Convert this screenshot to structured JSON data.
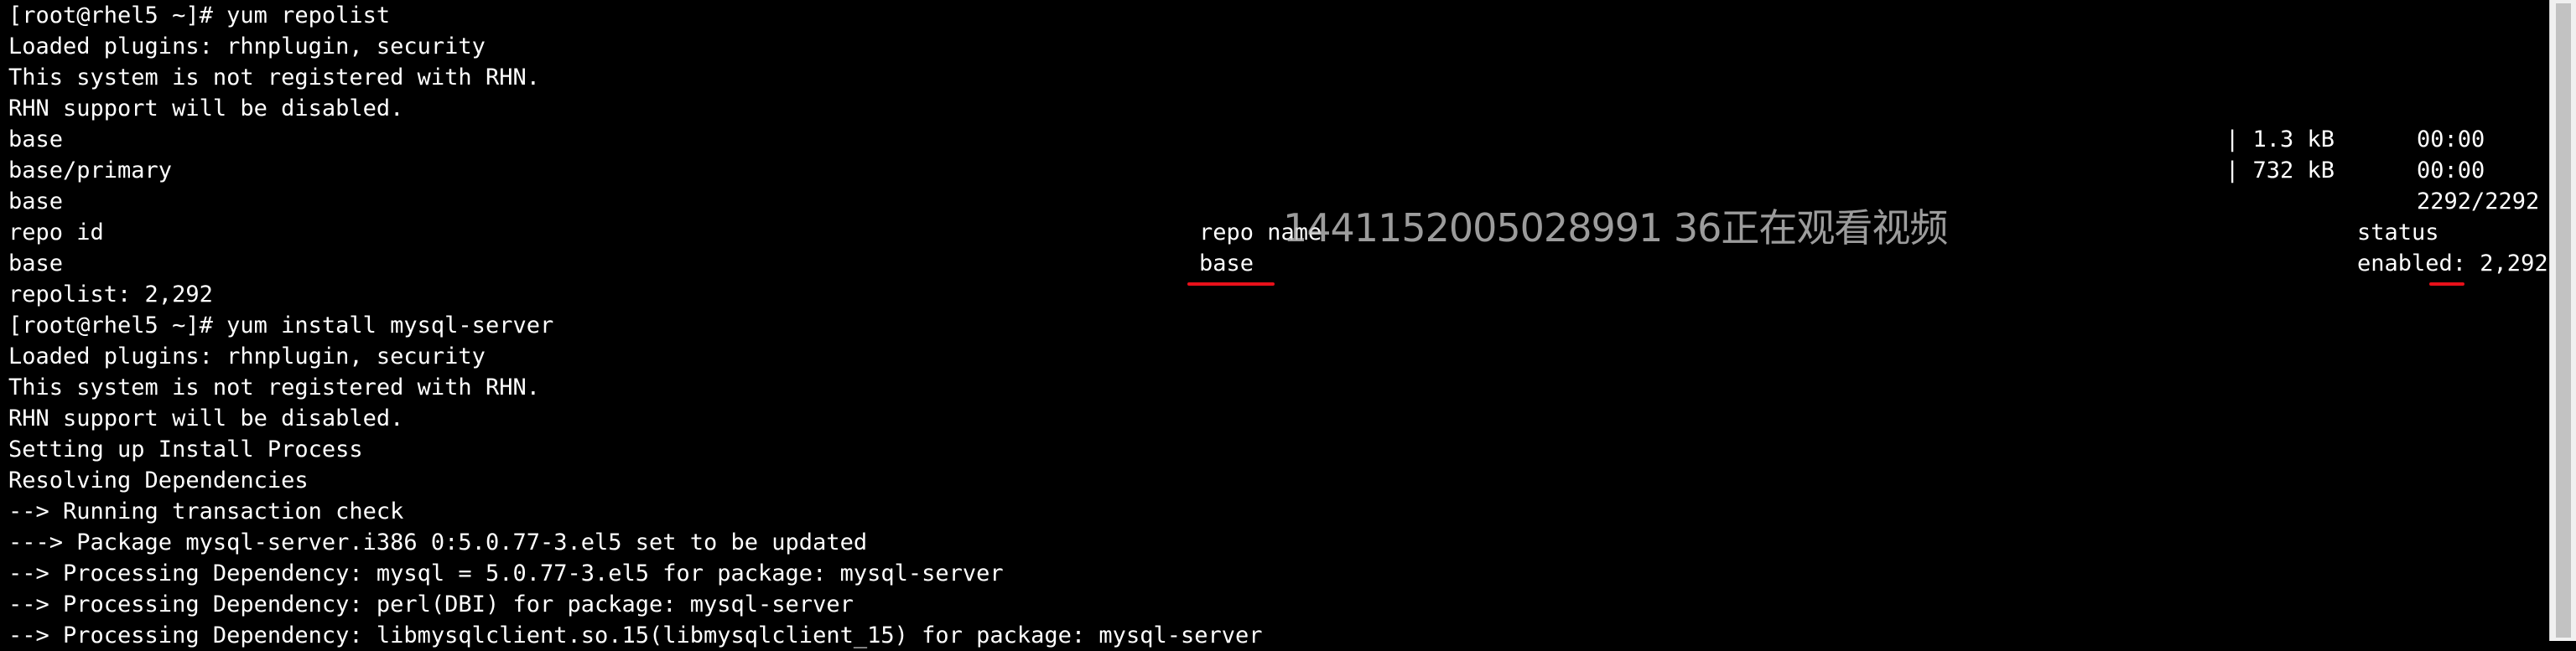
{
  "terminal": {
    "lines": [
      "[root@rhel5 ~]# yum repolist",
      "Loaded plugins: rhnplugin, security",
      "This system is not registered with RHN.",
      "RHN support will be disabled.",
      "base",
      "base/primary",
      "base",
      "repo id",
      "base",
      "repolist: 2,292",
      "[root@rhel5 ~]# yum install mysql-server",
      "Loaded plugins: rhnplugin, security",
      "This system is not registered with RHN.",
      "RHN support will be disabled.",
      "Setting up Install Process",
      "Resolving Dependencies",
      "--> Running transaction check",
      "---> Package mysql-server.i386 0:5.0.77-3.el5 set to be updated",
      "--> Processing Dependency: mysql = 5.0.77-3.el5 for package: mysql-server",
      "--> Processing Dependency: perl(DBI) for package: mysql-server",
      "--> Processing Dependency: libmysqlclient.so.15(libmysqlclient_15) for package: mysql-server"
    ],
    "download_rows": [
      {
        "size": "| 1.3 kB",
        "time": "00:00"
      },
      {
        "size": "| 732 kB",
        "time": "00:00"
      }
    ],
    "progress_count": "2292/2292",
    "repo_table": {
      "name_header": "repo name",
      "status_header": "status",
      "repo_name": "base",
      "repo_status": "enabled: 2,292"
    },
    "annotation_color": "#e8101a"
  },
  "overlay_text": "1441152005028991 36正在观看视频"
}
